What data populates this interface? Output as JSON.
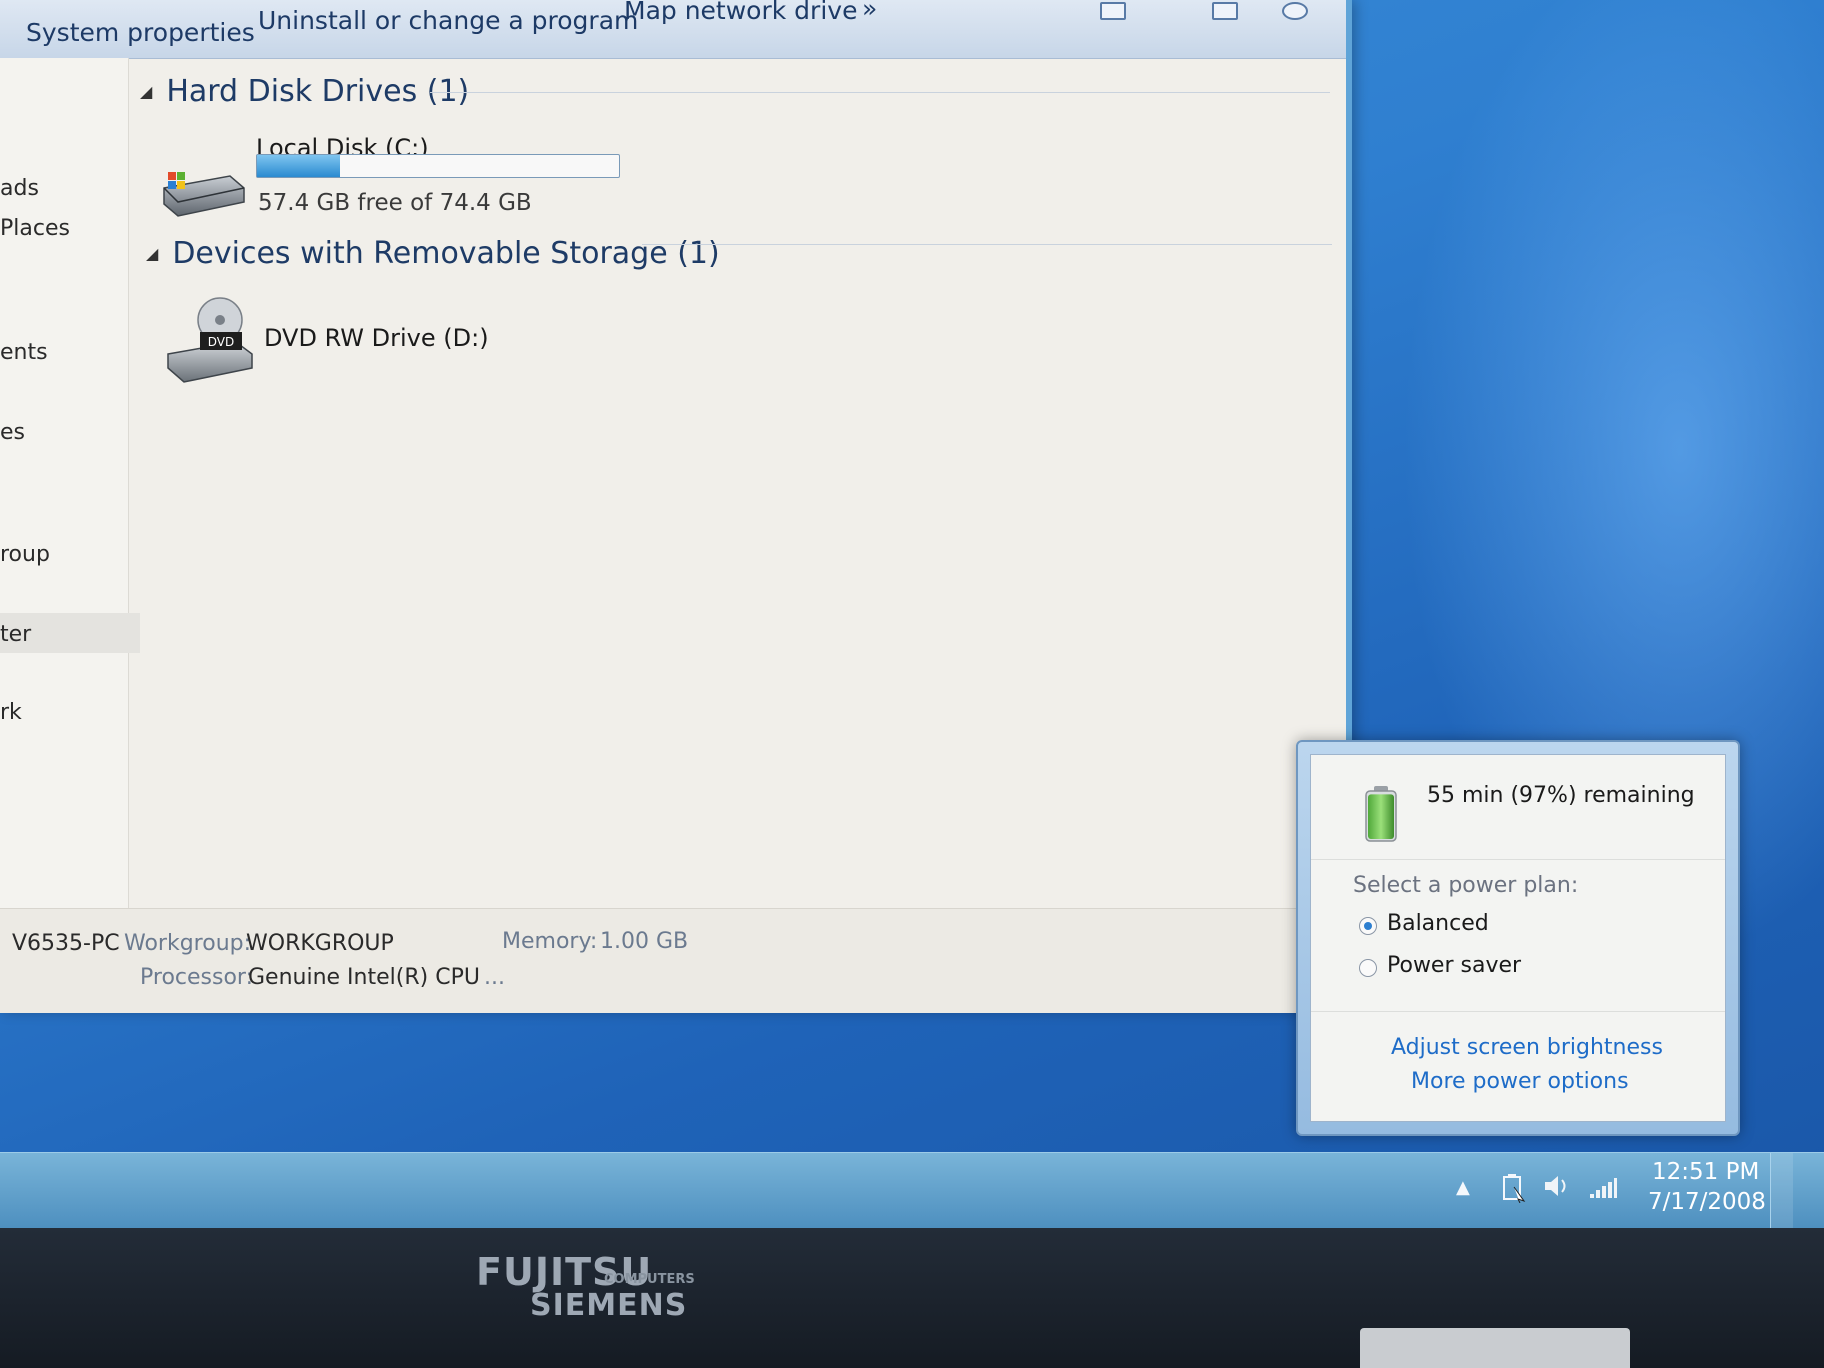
{
  "toolbar": {
    "system_properties": "System properties",
    "uninstall": "Uninstall or change a program",
    "map_drive": "Map network drive",
    "more": "»"
  },
  "nav": {
    "items": [
      "ads",
      "Places",
      "ents",
      "es",
      "roup",
      "ter",
      "rk"
    ]
  },
  "groups": {
    "hdd": {
      "title": "Hard Disk Drives (1)",
      "drive_name": "Local Disk (C:)",
      "free_text": "57.4 GB free of 74.4 GB",
      "used_fraction": 0.23
    },
    "removable": {
      "title": "Devices with Removable Storage (1)",
      "drive_name": "DVD RW Drive (D:)",
      "icon_label": "DVD"
    }
  },
  "details": {
    "pc_name": "V6535-PC",
    "workgroup_label": "Workgroup:",
    "workgroup_value": "WORKGROUP",
    "memory_label": "Memory:",
    "memory_value": "1.00 GB",
    "processor_label": "Processor:",
    "processor_value": "Genuine Intel(R) CPU",
    "ellipsis": "..."
  },
  "power": {
    "remaining": "55 min (97%) remaining",
    "battery_percent": 97,
    "plan_prompt": "Select a power plan:",
    "plans": [
      "Balanced",
      "Power saver"
    ],
    "selected_plan": "Balanced",
    "link_brightness": "Adjust screen brightness",
    "link_more": "More power options"
  },
  "taskbar": {
    "time": "12:51 PM",
    "date": "7/17/2008",
    "tray_arrow": "▲"
  },
  "bezel": {
    "brand_top": "FUJITSU",
    "brand_sub": "COMPUTERS",
    "brand_bottom": "SIEMENS"
  },
  "colors": {
    "link": "#1e6cc8",
    "bar_fill": "#2a8ad0",
    "desktop": "#2f7fd0"
  }
}
